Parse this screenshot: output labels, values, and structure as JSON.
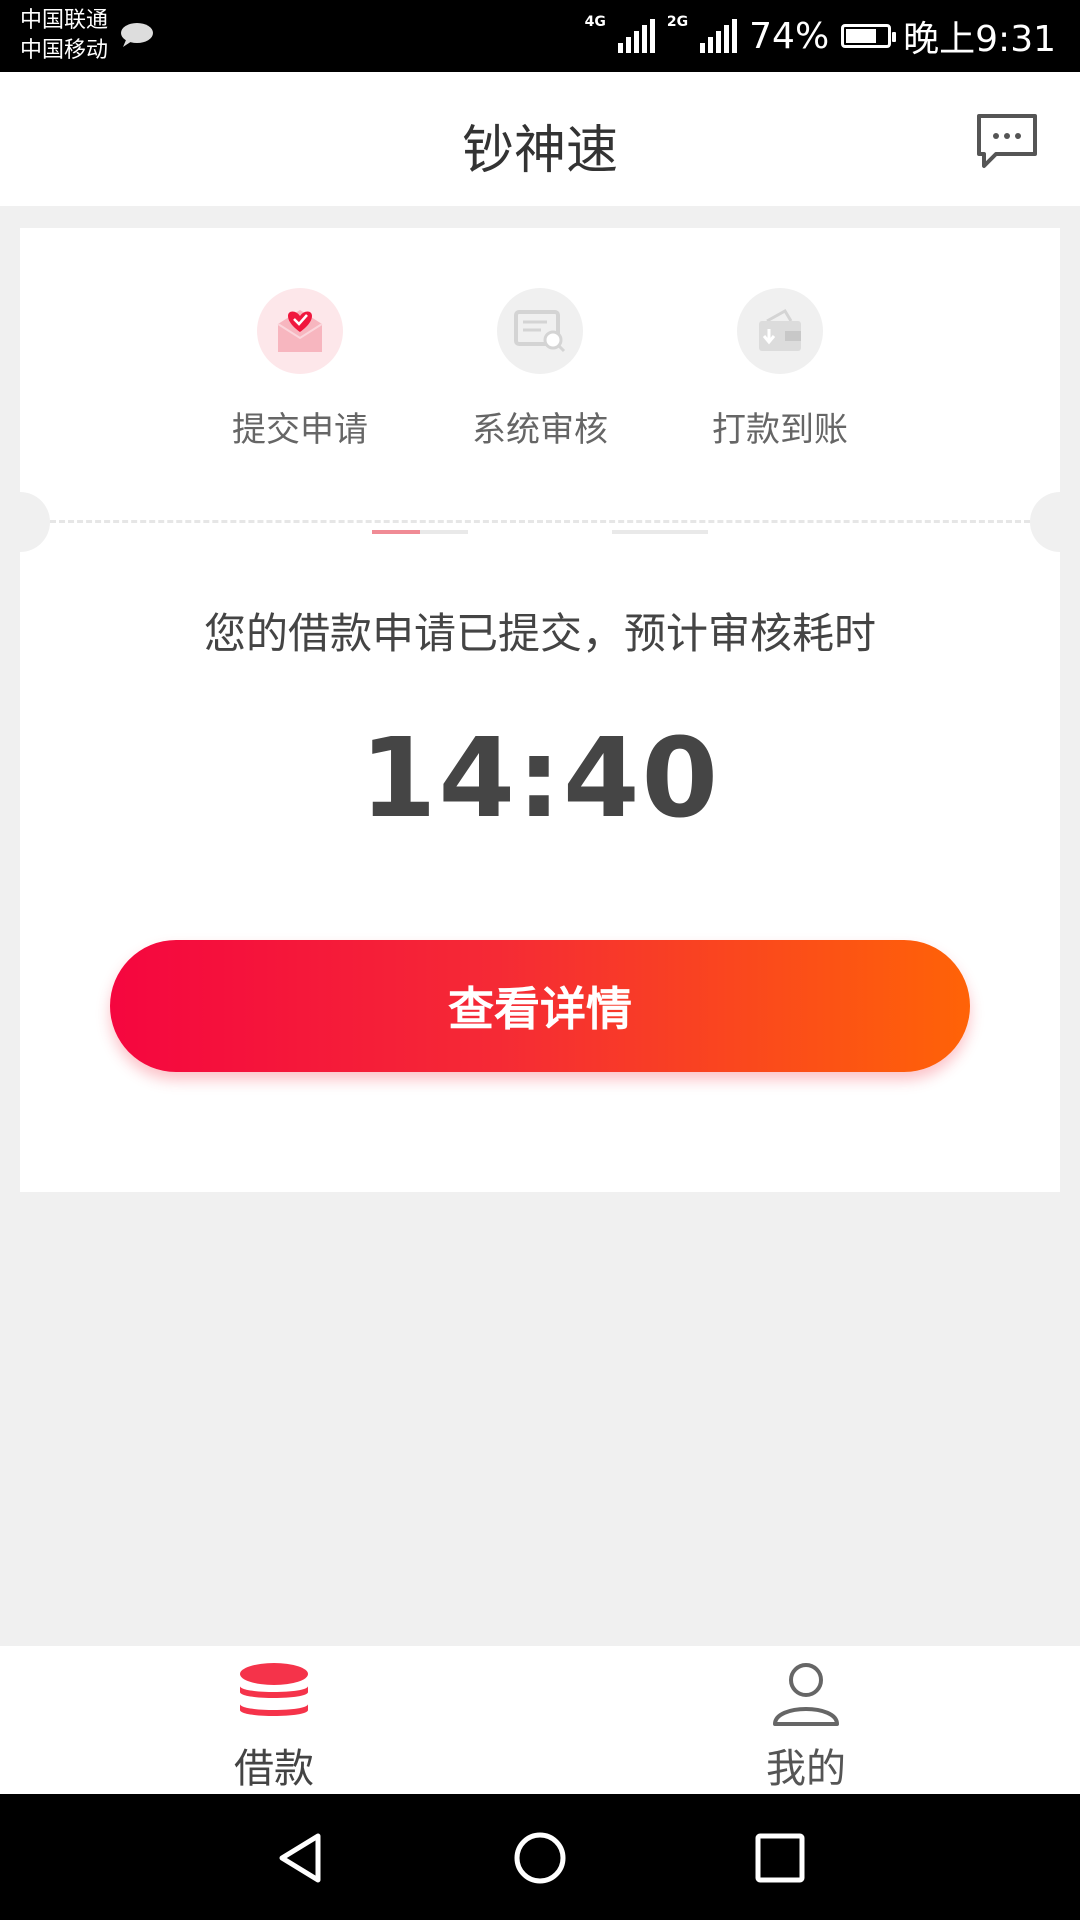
{
  "status_bar": {
    "carrier_1": "中国联通",
    "carrier_2": "中国移动",
    "net_1": "4G",
    "net_2": "2G",
    "battery_percent": "74%",
    "battery_level": 0.74,
    "time": "晚上9:31"
  },
  "header": {
    "title": "钞神速",
    "message_icon": "chat-bubble-icon"
  },
  "steps": [
    {
      "label": "提交申请",
      "icon": "envelope-heart-icon",
      "active": true
    },
    {
      "label": "系统审核",
      "icon": "document-search-icon",
      "active": false
    },
    {
      "label": "打款到账",
      "icon": "wallet-icon",
      "active": false
    }
  ],
  "progress": {
    "connector_1": 0.5,
    "connector_2": 0
  },
  "notice": "您的借款申请已提交，预计审核耗时",
  "countdown": "14:40",
  "detail_button": "查看详情",
  "tabs": [
    {
      "label": "借款",
      "icon": "coin-stack-icon",
      "active": true
    },
    {
      "label": "我的",
      "icon": "user-icon",
      "active": false
    }
  ],
  "colors": {
    "accent": "#f52a35",
    "gradient_start": "#f5063f",
    "gradient_end": "#ff6307",
    "background": "#f0f0f0"
  }
}
